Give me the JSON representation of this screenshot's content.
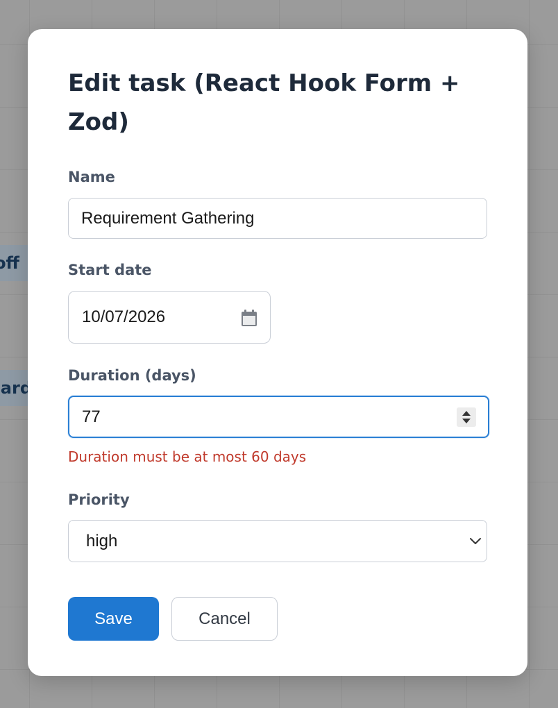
{
  "background": {
    "chips": [
      "off",
      "ard"
    ]
  },
  "modal": {
    "title": "Edit task (React Hook Form + Zod)",
    "fields": {
      "name": {
        "label": "Name",
        "value": "Requirement Gathering"
      },
      "start_date": {
        "label": "Start date",
        "value": "10/07/2026",
        "icon": "calendar-icon"
      },
      "duration": {
        "label": "Duration (days)",
        "value": "77",
        "error": "Duration must be at most 60 days"
      },
      "priority": {
        "label": "Priority",
        "value": "high",
        "icon": "chevron-down-icon"
      }
    },
    "buttons": {
      "save": "Save",
      "cancel": "Cancel"
    }
  },
  "colors": {
    "accent": "#1f78d1",
    "focus_border": "#2a7fd4",
    "error": "#c0392b",
    "overlay": "#9b9b9b"
  }
}
